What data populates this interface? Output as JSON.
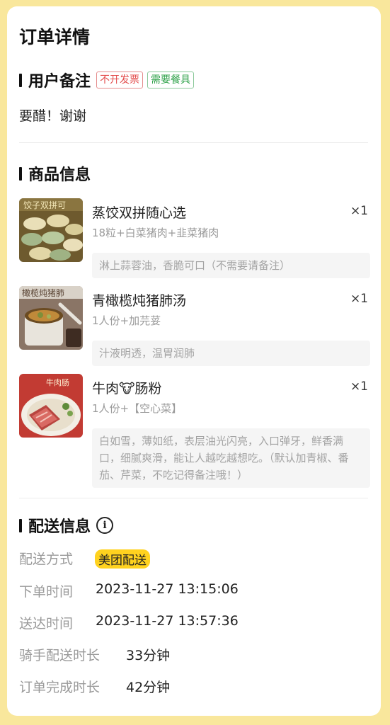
{
  "page": {
    "title": "订单详情"
  },
  "remark_section": {
    "title": "用户备注",
    "tags": [
      "不开发票",
      "需要餐具"
    ],
    "text": "要醋！谢谢"
  },
  "goods_section": {
    "title": "商品信息",
    "items": [
      {
        "name": "蒸饺双拼随心选",
        "qty": "×1",
        "spec": "18粒+白菜猪肉+韭菜猪肉",
        "remark": "淋上蒜蓉油，香脆可口（不需要请备注）",
        "thumb_label": "饺子双拼可",
        "thumb_icon": "dumplings-photo"
      },
      {
        "name": "青橄榄炖猪肺汤",
        "qty": "×1",
        "spec": "1人份+加芫荽",
        "remark": "汁液明透，温胃润肺",
        "thumb_label": "橄榄炖猪肺",
        "thumb_icon": "soup-photo"
      },
      {
        "name": "牛肉🐮肠粉",
        "qty": "×1",
        "spec": "1人份+【空心菜】",
        "remark": "白如雪，薄如纸，表层油光闪亮，入口弹牙，鲜香满口，细腻爽滑，能让人越吃越想吃。（默认加青椒、番茄、芹菜，不吃记得备注哦！）",
        "thumb_label": "牛肉肠",
        "thumb_icon": "rice-noodle-roll-photo"
      }
    ]
  },
  "delivery_section": {
    "title": "配送信息",
    "rows": [
      {
        "label": "配送方式",
        "value": "美团配送"
      },
      {
        "label": "下单时间",
        "value": "2023-11-27 13:15:06"
      },
      {
        "label": "送达时间",
        "value": "2023-11-27 13:57:36"
      },
      {
        "label": "骑手配送时长",
        "value": "33分钟"
      },
      {
        "label": "订单完成时长",
        "value": "42分钟"
      }
    ]
  },
  "colors": {
    "background": "#f9e79c",
    "badge": "#ffd21f",
    "tag_red": "#e34d4d",
    "tag_green": "#2fa24a"
  }
}
